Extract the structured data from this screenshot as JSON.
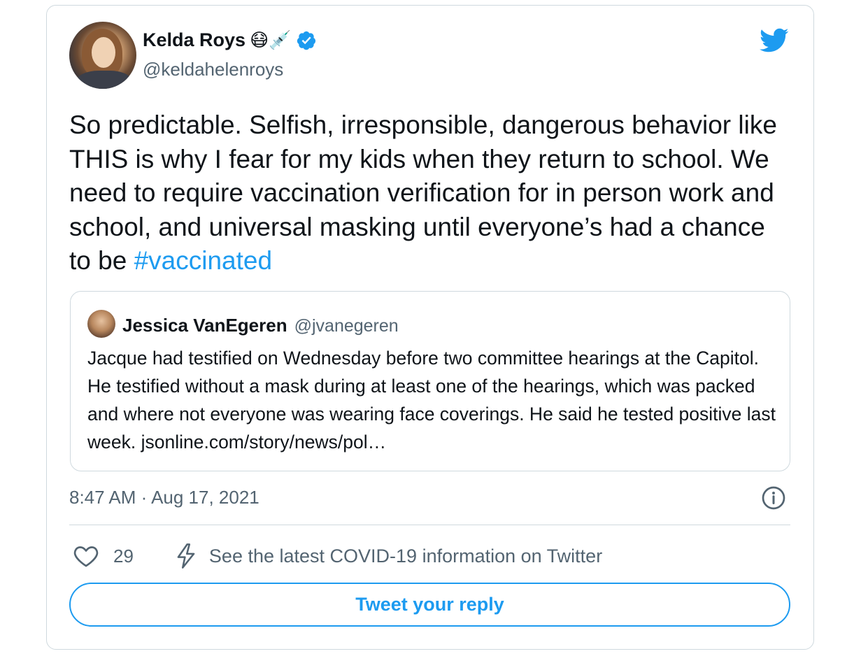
{
  "author": {
    "name": "Kelda Roys",
    "name_emojis": "😷💉",
    "handle": "@keldahelenroys",
    "verified": true
  },
  "tweet": {
    "text": "So predictable. Selfish, irresponsible, dangerous behavior like THIS is why I fear for my kids when they return to school. We need to require vaccination verification for in person work and school, and universal masking until everyone’s had a chance to be ",
    "hashtag": "#vaccinated",
    "timestamp": "8:47 AM · Aug 17, 2021"
  },
  "quoted": {
    "name": "Jessica VanEgeren",
    "handle": "@jvanegeren",
    "text": "Jacque had testified on Wednesday before two committee hearings at the Capitol. He testified without a mask during at least one of the hearings, which was packed and where not everyone was wearing face coverings. He said he tested positive last week.  jsonline.com/story/news/pol…"
  },
  "actions": {
    "like_count": "29",
    "covid_info": "See the latest COVID-19 information on Twitter",
    "reply_label": "Tweet your reply"
  },
  "icons": {
    "brand": "twitter-bird-icon",
    "verified": "verified-badge-icon",
    "info": "info-icon",
    "like": "heart-icon",
    "covid": "lightning-bolt-icon"
  },
  "colors": {
    "accent": "#1d9bf0",
    "secondary_text": "#536471",
    "border": "#cfd9de"
  }
}
